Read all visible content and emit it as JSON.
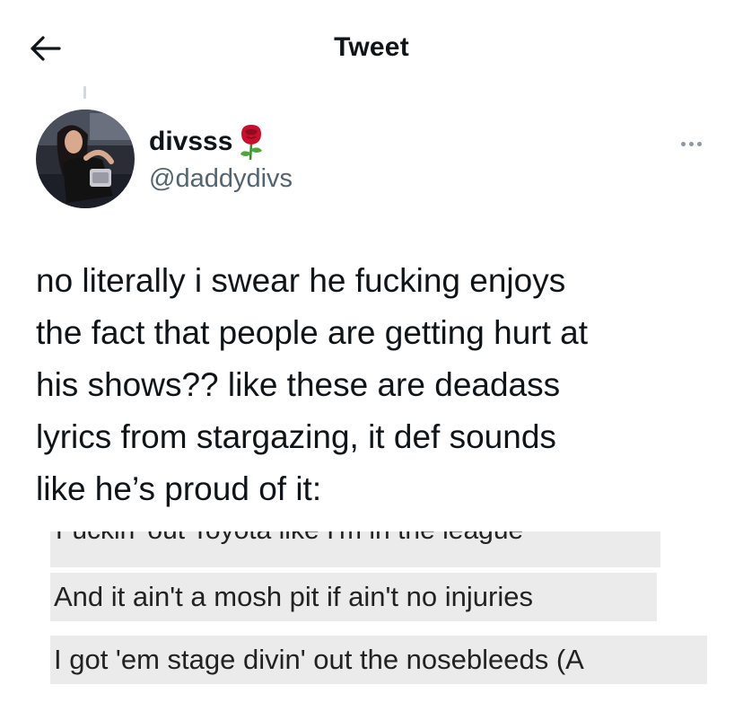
{
  "header": {
    "title": "Tweet"
  },
  "author": {
    "name": "divsss",
    "handle": "@daddydivs"
  },
  "tweet": {
    "text": "no literally i swear he fucking enjoys\nthe fact that people are getting hurt at\nhis shows?? like these are deadass\nlyrics from stargazing, it def sounds\nlike he’s proud of it:"
  },
  "image": {
    "cut_off_line": "Fuckin' out Toyota like I'm in the league",
    "lines": [
      "And it ain't a mosh pit if ain't no injuries",
      "I got 'em stage divin' out the nosebleeds (A"
    ]
  },
  "colors": {
    "text": "#0f1419",
    "secondary": "#536471",
    "highlight": "#ebebeb"
  },
  "icons": {
    "back": "arrow-left-icon",
    "more": "more-dots-icon",
    "emoji": "rose-emoji-icon"
  }
}
